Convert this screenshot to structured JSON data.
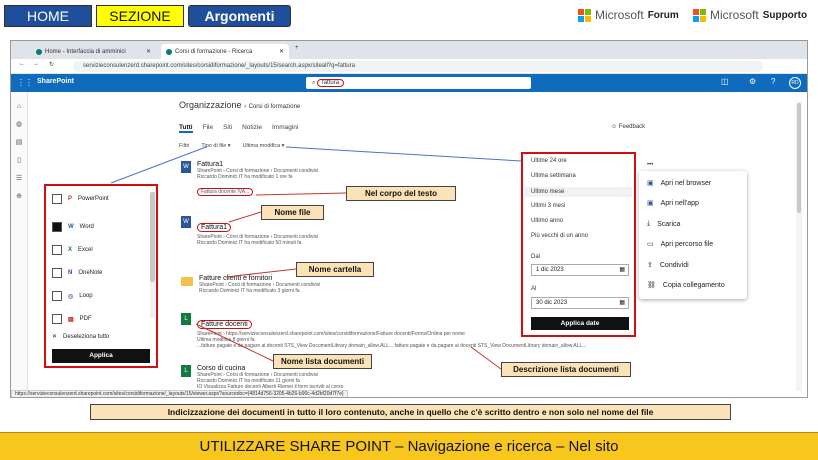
{
  "header": {
    "home": "HOME",
    "sezione": "SEZIONE",
    "argomenti": "Argomenti",
    "microsoft1": "Microsoft",
    "forum": "Forum",
    "microsoft2": "Microsoft",
    "supporto": "Supporto"
  },
  "browser": {
    "tabs": [
      "Home - Interfaccia di amminici",
      "Corsi di formazione - Ricerca"
    ],
    "url": "servizieconsulenzerd.sharepoint.com/sites/corsidiformazione/_layouts/15/search.aspx/siteall?q=fattura",
    "status_url": "https://servizieconsulenzerd.sharepoint.com/sites/corsidiformazione/_layouts/15/viewer.aspx?sourcedoc={4814d756-3205-4b26-b90c-4d2bf20d7f7e}"
  },
  "sharepoint": {
    "brand": "SharePoint",
    "search_value": "fattura",
    "avatar": "RD",
    "breadcrumb_org": "Organizzazione",
    "breadcrumb_site": "Corsi di formazione",
    "tabs": [
      "Tutti",
      "File",
      "Siti",
      "Notizie",
      "Immagini"
    ],
    "feedback": "Feedback",
    "filter_label": "Filtri",
    "filter_type": "Tipo di file",
    "filter_modified": "Ultima modifica"
  },
  "filetypes": {
    "items": [
      "PowerPoint",
      "Word",
      "Excel",
      "OneNote",
      "Loop",
      "PDF"
    ],
    "checked": [
      false,
      true,
      false,
      false,
      false,
      false
    ],
    "deselect": "Deseleziona tutto",
    "apply": "Applica"
  },
  "modified": {
    "options": [
      "Ultime 24 ore",
      "Ultima settimana",
      "Ultimo mese",
      "Ultimi 3 mesi",
      "Ultimo anno",
      "Più vecchi di un anno"
    ],
    "from_label": "Dal",
    "from_value": "1 dic 2023",
    "to_label": "Al",
    "to_value": "30 dic 2023",
    "apply": "Applica date"
  },
  "context_menu": {
    "items": [
      "Apri nel browser",
      "Apri nell'app",
      "Scarica",
      "Apri percorso file",
      "Condividi",
      "Copia collegamento"
    ]
  },
  "results": [
    {
      "title": "Fattura1",
      "path": "SharePoint › Corsi di formazione › Documenti condivisi",
      "meta": "Riccardo Dominici IT ha modificato 1 ore fa",
      "snippet": "Fattura docente IVA..."
    },
    {
      "title": "Fattura1",
      "path": "SharePoint › Corsi di formazione › Documenti condivisi",
      "meta": "Riccardo Dominici IT ha modificato 50 minuti fa",
      "snippet": ""
    },
    {
      "title": "Fatture clienti e fornitori",
      "path": "SharePoint › Corsi di formazione › Documenti condivisi",
      "meta": "Riccardo Dominici IT ha modificato 3 giorni fa",
      "snippet": ""
    },
    {
      "title": "Fatture docenti",
      "path": "SharePoint › https://servizieconsulenzerd.sharepoint.com/sites/corsidiformazione/Fatture docenti/Forms/Ordina per nome",
      "meta": "Ultima modifica 8 giorni fa",
      "snippet": "...fatture pagate e da pagare ai docenti STS_View DocumentLibrary domain_allow.ALL... fatture pagate e da pagare ai docenti STS_View DocumentLibrary domain_allow.ALL..."
    },
    {
      "title": "Corso di cucina",
      "path": "SharePoint › Corsi di formazione › Documenti condivisi",
      "meta": "Riccardo Dominici IT ha modificato 11 giorni fa",
      "snippet": "IO Visualizza Fatture docenti Alberti Riemei il form iscriviti al corso"
    }
  ],
  "callouts": {
    "nel_corpo": "Nel corpo del testo",
    "nome_file": "Nome file",
    "nome_cartella": "Nome cartella",
    "nome_lista": "Nome lista documenti",
    "descrizione": "Descrizione lista documenti"
  },
  "note": "Indicizzazione dei documenti in tutto il loro contenuto, anche in quello che c'è scritto dentro e non solo nel nome del file",
  "footer": "UTILIZZARE SHARE POINT – Navigazione e ricerca – Nel sito",
  "colors": {
    "yellow": "#ffff00",
    "blue": "#1f4e9a",
    "callout": "#fbe3b7",
    "red": "#d01010",
    "footer": "#f7c71d",
    "sp_blue": "#0f6cbd"
  }
}
